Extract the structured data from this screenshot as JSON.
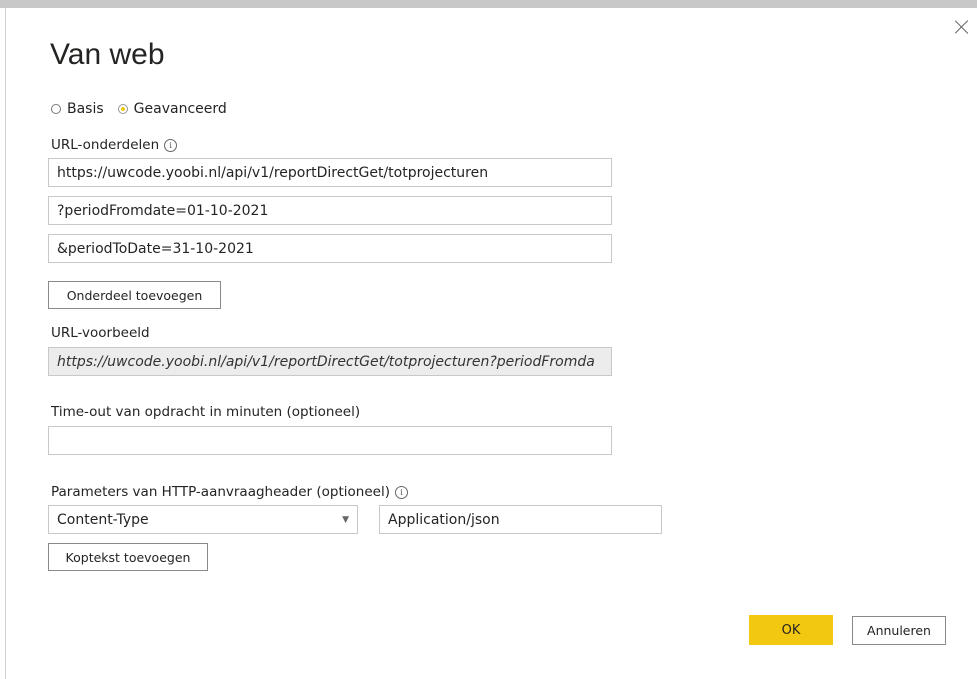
{
  "dialog": {
    "title": "Van web"
  },
  "mode": {
    "options": [
      "Basis",
      "Geavanceerd"
    ],
    "selected": "Geavanceerd"
  },
  "url_parts": {
    "label": "URL-onderdelen",
    "parts": [
      "https://uwcode.yoobi.nl/api/v1/reportDirectGet/totprojecturen",
      "?periodFromdate=01-10-2021",
      "&periodToDate=31-10-2021"
    ],
    "add_button": "Onderdeel toevoegen"
  },
  "url_preview": {
    "label": "URL-voorbeeld",
    "value": "https://uwcode.yoobi.nl/api/v1/reportDirectGet/totprojecturen?periodFromda"
  },
  "timeout": {
    "label": "Time-out van opdracht in minuten (optioneel)",
    "value": ""
  },
  "headers": {
    "label": "Parameters van HTTP-aanvraagheader (optioneel)",
    "name_selected": "Content-Type",
    "value": "Application/json",
    "add_button": "Koptekst toevoegen"
  },
  "footer": {
    "ok_label": "OK",
    "cancel_label": "Annuleren"
  },
  "colors": {
    "accent": "#f2c811"
  }
}
